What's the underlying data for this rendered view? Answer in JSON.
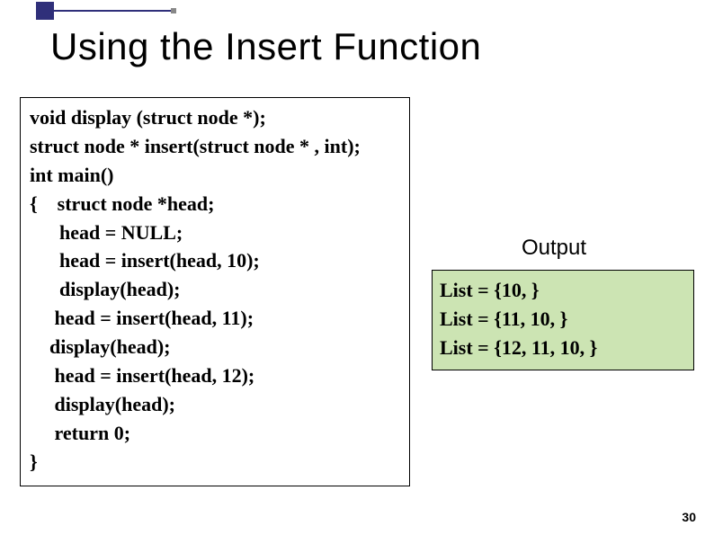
{
  "title": "Using the Insert Function",
  "code": {
    "lines": [
      "void display (struct node *);",
      "struct node * insert(struct node * , int);",
      "int main()",
      "{    struct node *head;",
      "      head = NULL;",
      "      head = insert(head, 10);",
      "      display(head);",
      "     head = insert(head, 11);",
      "    display(head);",
      "     head = insert(head, 12);",
      "     display(head);",
      "     return 0;",
      "}"
    ]
  },
  "output": {
    "label": "Output",
    "lines": [
      "List = {10, }",
      "List = {11, 10, }",
      "List = {12, 11, 10, }"
    ]
  },
  "page_number": "30"
}
